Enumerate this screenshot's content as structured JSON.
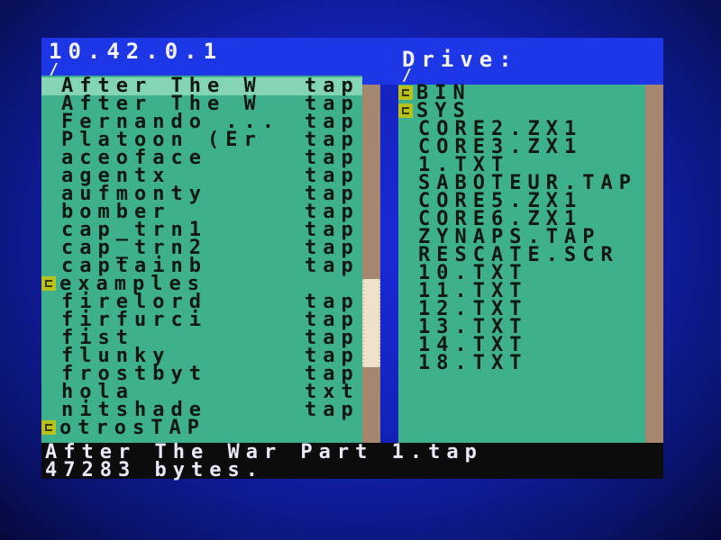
{
  "header": {
    "left_title": "10.42.0.1",
    "left_path": "/",
    "right_title": "Drive:",
    "right_path": "/"
  },
  "left_panel": {
    "rows": [
      {
        "name": "After The W",
        "ext": "tap",
        "is_dir": false,
        "selected": true
      },
      {
        "name": "After The W",
        "ext": "tap",
        "is_dir": false,
        "selected": false
      },
      {
        "name": "Fernando ...",
        "ext": "tap",
        "is_dir": false,
        "selected": false
      },
      {
        "name": "Platoon (Er",
        "ext": "tap",
        "is_dir": false,
        "selected": false
      },
      {
        "name": "aceoface",
        "ext": "tap",
        "is_dir": false,
        "selected": false
      },
      {
        "name": "agentx",
        "ext": "tap",
        "is_dir": false,
        "selected": false
      },
      {
        "name": "aufmonty",
        "ext": "tap",
        "is_dir": false,
        "selected": false
      },
      {
        "name": "bomber",
        "ext": "tap",
        "is_dir": false,
        "selected": false
      },
      {
        "name": "cap_trn1",
        "ext": "tap",
        "is_dir": false,
        "selected": false
      },
      {
        "name": "cap_trn2",
        "ext": "tap",
        "is_dir": false,
        "selected": false
      },
      {
        "name": "captainb",
        "ext": "tap",
        "is_dir": false,
        "selected": false
      },
      {
        "name": "examples",
        "ext": "",
        "is_dir": true,
        "selected": false
      },
      {
        "name": "firelord",
        "ext": "tap",
        "is_dir": false,
        "selected": false
      },
      {
        "name": "firfurci",
        "ext": "tap",
        "is_dir": false,
        "selected": false
      },
      {
        "name": "fist",
        "ext": "tap",
        "is_dir": false,
        "selected": false
      },
      {
        "name": "flunky",
        "ext": "tap",
        "is_dir": false,
        "selected": false
      },
      {
        "name": "frostbyt",
        "ext": "tap",
        "is_dir": false,
        "selected": false
      },
      {
        "name": "hola",
        "ext": "txt",
        "is_dir": false,
        "selected": false
      },
      {
        "name": "nitshade",
        "ext": "tap",
        "is_dir": false,
        "selected": false
      },
      {
        "name": "otrosTAP",
        "ext": "",
        "is_dir": true,
        "selected": false
      }
    ],
    "scroll_position": 0.72
  },
  "right_panel": {
    "rows": [
      {
        "name": "BIN",
        "is_dir": true
      },
      {
        "name": "SYS",
        "is_dir": true
      },
      {
        "name": "CORE2.ZX1",
        "is_dir": false
      },
      {
        "name": "CORE3.ZX1",
        "is_dir": false
      },
      {
        "name": "1.TXT",
        "is_dir": false
      },
      {
        "name": "SABOTEUR.TAP",
        "is_dir": false
      },
      {
        "name": "CORE5.ZX1",
        "is_dir": false
      },
      {
        "name": "CORE6.ZX1",
        "is_dir": false
      },
      {
        "name": "ZYNAPS.TAP",
        "is_dir": false
      },
      {
        "name": "RESCATE.SCR",
        "is_dir": false
      },
      {
        "name": "10.TXT",
        "is_dir": false
      },
      {
        "name": "11.TXT",
        "is_dir": false
      },
      {
        "name": "12.TXT",
        "is_dir": false
      },
      {
        "name": "13.TXT",
        "is_dir": false
      },
      {
        "name": "14.TXT",
        "is_dir": false
      },
      {
        "name": "18.TXT",
        "is_dir": false
      }
    ]
  },
  "status": {
    "filename": "After The War Part 1.tap",
    "size": "47283 bytes."
  },
  "colors": {
    "header_bg": "#1e37e6",
    "panel_bg": "#3fb08c",
    "selected_bg": "#83d5b4",
    "folder_icon": "#b9c21d",
    "status_bg": "#0c0c0c"
  }
}
